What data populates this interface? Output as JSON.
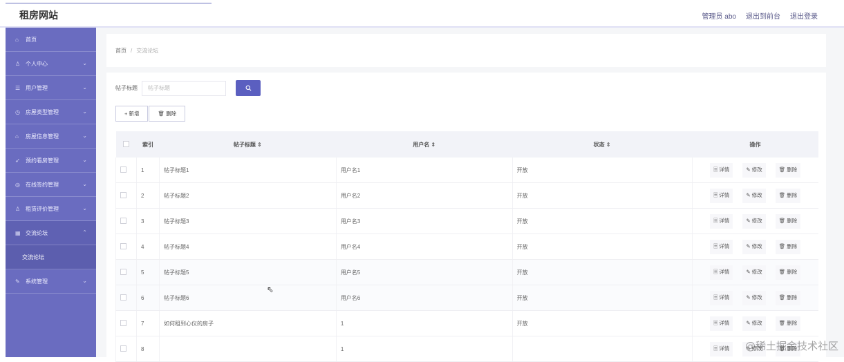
{
  "header": {
    "brand": "租房网站",
    "links": [
      "管理员 abo",
      "退出到前台",
      "退出登录"
    ]
  },
  "sidebar": {
    "items": [
      {
        "label": "首页",
        "icon": "home-icon",
        "glyph": "⌂",
        "chevron": ""
      },
      {
        "label": "个人中心",
        "icon": "user-icon",
        "glyph": "♙",
        "chevron": "⌄"
      },
      {
        "label": "用户管理",
        "icon": "list-icon",
        "glyph": "☰",
        "chevron": "⌄"
      },
      {
        "label": "房屋类型管理",
        "icon": "clock-icon",
        "glyph": "◷",
        "chevron": "⌄"
      },
      {
        "label": "房屋信息管理",
        "icon": "house-icon",
        "glyph": "⌂",
        "chevron": "⌄"
      },
      {
        "label": "预约看房管理",
        "icon": "send-icon",
        "glyph": "➶",
        "chevron": "⌄"
      },
      {
        "label": "在线签约管理",
        "icon": "globe-icon",
        "glyph": "◎",
        "chevron": "⌄"
      },
      {
        "label": "租赁评价管理",
        "icon": "person-icon",
        "glyph": "♙",
        "chevron": "⌄"
      },
      {
        "label": "交流论坛",
        "icon": "grid-icon",
        "glyph": "▦",
        "chevron": "⌃"
      },
      {
        "label": "系统管理",
        "icon": "pencil-icon",
        "glyph": "✎",
        "chevron": "⌄"
      }
    ],
    "sub_item": "交流论坛"
  },
  "breadcrumb": {
    "home": "首页",
    "separator": "/",
    "current": "交流论坛"
  },
  "search": {
    "label": "帖子标题",
    "placeholder": "帖子标题"
  },
  "buttons": {
    "add": "+ 新增",
    "delete": "🗑 删除"
  },
  "table": {
    "headers": [
      "索引",
      "帖子标题 ⇕",
      "用户名 ⇕",
      "状态 ⇕",
      "操作"
    ],
    "op_labels": [
      "🗏 详情",
      "✎ 修改",
      "🗑 删除"
    ],
    "rows": [
      {
        "index": "1",
        "title": "帖子标题1",
        "user": "用户名1",
        "status": "开放"
      },
      {
        "index": "2",
        "title": "帖子标题2",
        "user": "用户名2",
        "status": "开放"
      },
      {
        "index": "3",
        "title": "帖子标题3",
        "user": "用户名3",
        "status": "开放"
      },
      {
        "index": "4",
        "title": "帖子标题4",
        "user": "用户名4",
        "status": "开放"
      },
      {
        "index": "5",
        "title": "帖子标题5",
        "user": "用户名5",
        "status": "开放"
      },
      {
        "index": "6",
        "title": "帖子标题6",
        "user": "用户名6",
        "status": "开放"
      },
      {
        "index": "7",
        "title": "如何租到心仪的房子",
        "user": "1",
        "status": "开放"
      },
      {
        "index": "8",
        "title": "",
        "user": "1",
        "status": ""
      }
    ]
  },
  "watermark": "@稀土掘金技术社区",
  "colors": {
    "sidebar": "#6a6cc0",
    "accent": "#5b5fc0"
  }
}
